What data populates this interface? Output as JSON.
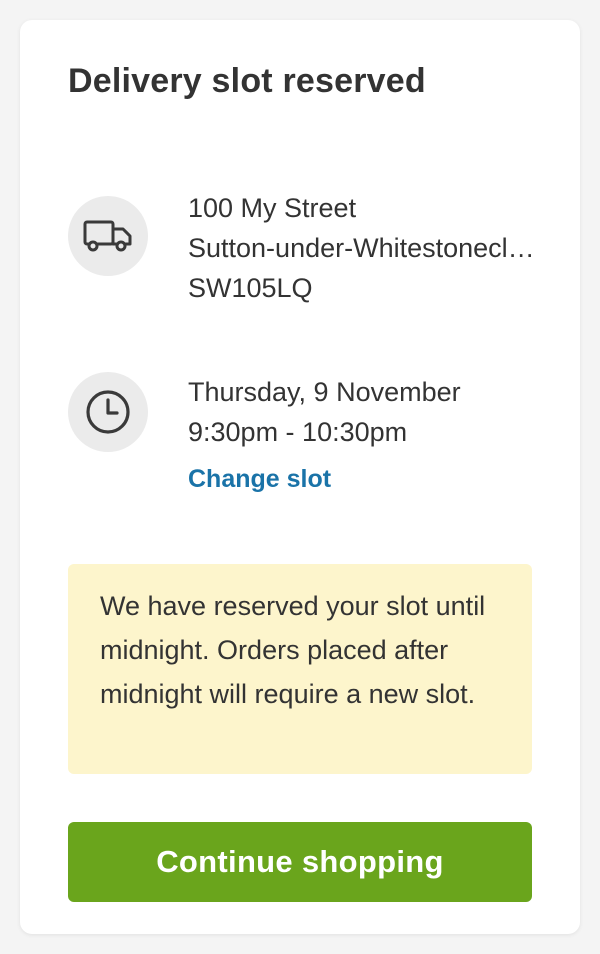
{
  "card": {
    "title": "Delivery slot reserved"
  },
  "address": {
    "icon": "truck-icon",
    "line1": "100 My Street",
    "line2": "Sutton-under-Whitestonecliffe",
    "line3": "SW105LQ"
  },
  "slot": {
    "icon": "clock-icon",
    "date": "Thursday, 9 November",
    "time": "9:30pm - 10:30pm",
    "change_label": "Change slot"
  },
  "notice": {
    "text": "We have reserved your slot until midnight. Orders placed after midnight will require a new slot."
  },
  "actions": {
    "continue_label": "Continue shopping"
  },
  "colors": {
    "primary_button": "#6aa51c",
    "link": "#1a73a8",
    "notice_background": "#fdf5cc",
    "icon_background": "#ebebeb"
  }
}
